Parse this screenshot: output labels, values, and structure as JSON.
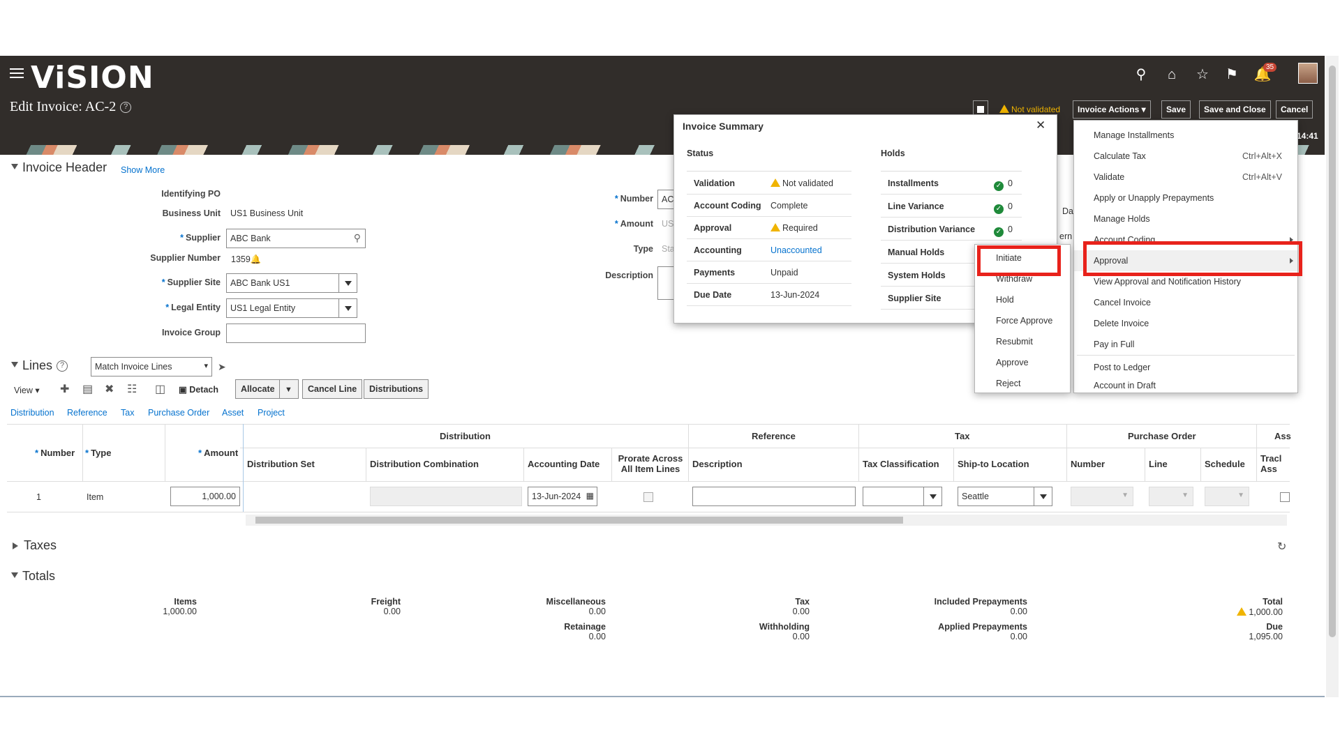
{
  "app": {
    "logo": "ViSION",
    "page_title": "Edit Invoice: AC-2",
    "help": "?",
    "notif_count": "35",
    "time": "14:41"
  },
  "header_actions": {
    "status": "Not validated",
    "invoice_actions": "Invoice Actions",
    "save": "Save",
    "save_close": "Save and Close",
    "cancel": "Cancel"
  },
  "invoice_header": {
    "title": "Invoice Header",
    "show_more": "Show More",
    "identifying_po_label": "Identifying PO",
    "business_unit_label": "Business Unit",
    "business_unit": "US1 Business Unit",
    "supplier_label": "Supplier",
    "supplier": "ABC Bank",
    "supplier_number_label": "Supplier Number",
    "supplier_number": "1359",
    "supplier_site_label": "Supplier Site",
    "supplier_site": "ABC Bank US1",
    "legal_entity_label": "Legal Entity",
    "legal_entity": "US1 Legal Entity",
    "invoice_group_label": "Invoice Group",
    "invoice_group": "",
    "number_label": "Number",
    "number": "AC",
    "amount_label": "Amount",
    "amount_partial": "US",
    "type_label": "Type",
    "type_partial": "Sta",
    "description_label": "Description",
    "date_partial": "Da",
    "terms_partial": "ern"
  },
  "lines": {
    "title": "Lines",
    "match_select": "Match Invoice Lines",
    "view": "View",
    "detach": "Detach",
    "allocate": "Allocate",
    "cancel_line": "Cancel Line",
    "distributions": "Distributions",
    "tabs": [
      "Distribution",
      "Reference",
      "Tax",
      "Purchase Order",
      "Asset",
      "Project"
    ],
    "groups": {
      "distribution": "Distribution",
      "reference": "Reference",
      "tax": "Tax",
      "po": "Purchase Order",
      "asset": "Ass"
    },
    "columns": {
      "number": "Number",
      "type": "Type",
      "amount": "Amount",
      "dist_set": "Distribution Set",
      "dist_comb": "Distribution Combination",
      "acct_date": "Accounting Date",
      "prorate": "Prorate Across All Item Lines",
      "description": "Description",
      "tax_class": "Tax Classification",
      "ship_to": "Ship-to Location",
      "po_number": "Number",
      "po_line": "Line",
      "po_schedule": "Schedule",
      "track_asset": "Tracl Ass"
    },
    "rows": [
      {
        "number": "1",
        "type": "Item",
        "amount": "1,000.00",
        "acct_date": "13-Jun-2024",
        "ship_to": "Seattle"
      }
    ]
  },
  "taxes": {
    "title": "Taxes"
  },
  "totals": {
    "title": "Totals",
    "items_label": "Items",
    "items": "1,000.00",
    "freight_label": "Freight",
    "freight": "0.00",
    "misc_label": "Miscellaneous",
    "misc": "0.00",
    "retainage_label": "Retainage",
    "retainage": "0.00",
    "tax_label": "Tax",
    "tax": "0.00",
    "withholding_label": "Withholding",
    "withholding": "0.00",
    "incl_prepay_label": "Included Prepayments",
    "incl_prepay": "0.00",
    "appl_prepay_label": "Applied Prepayments",
    "appl_prepay": "0.00",
    "total_label": "Total",
    "total": "1,000.00",
    "due_label": "Due",
    "due": "1,095.00"
  },
  "summary": {
    "title": "Invoice Summary",
    "status_h": "Status",
    "holds_h": "Holds",
    "status_rows": [
      {
        "label": "Validation",
        "value": "Not validated"
      },
      {
        "label": "Account Coding",
        "value": "Complete"
      },
      {
        "label": "Approval",
        "value": "Required"
      },
      {
        "label": "Accounting",
        "value": "Unaccounted"
      },
      {
        "label": "Payments",
        "value": "Unpaid"
      },
      {
        "label": "Due Date",
        "value": "13-Jun-2024"
      }
    ],
    "hold_rows": [
      {
        "label": "Installments",
        "value": "0"
      },
      {
        "label": "Line Variance",
        "value": "0"
      },
      {
        "label": "Distribution Variance",
        "value": "0"
      },
      {
        "label": "Manual Holds",
        "value": ""
      },
      {
        "label": "System Holds",
        "value": ""
      },
      {
        "label": "Supplier Site",
        "value": ""
      }
    ]
  },
  "actions_menu": [
    {
      "label": "Manage Installments",
      "shortcut": ""
    },
    {
      "label": "Calculate Tax",
      "shortcut": "Ctrl+Alt+X"
    },
    {
      "label": "Validate",
      "shortcut": "Ctrl+Alt+V"
    },
    {
      "label": "Apply or Unapply Prepayments",
      "shortcut": ""
    },
    {
      "label": "Manage Holds",
      "shortcut": ""
    },
    {
      "label": "Account Coding",
      "shortcut": ""
    },
    {
      "label": "Approval",
      "shortcut": ""
    },
    {
      "label": "View Approval and Notification History",
      "shortcut": ""
    },
    {
      "label": "Cancel Invoice",
      "shortcut": ""
    },
    {
      "label": "Delete Invoice",
      "shortcut": ""
    },
    {
      "label": "Pay in Full",
      "shortcut": ""
    },
    {
      "label": "Post to Ledger",
      "shortcut": ""
    },
    {
      "label": "Account in Draft",
      "shortcut": ""
    }
  ],
  "approval_submenu": [
    "Initiate",
    "Withdraw",
    "Hold",
    "Force Approve",
    "Resubmit",
    "Approve",
    "Reject"
  ],
  "colors": {
    "header_bg": "#312d2a",
    "link": "#0572ce",
    "highlight": "#e8221b",
    "warning": "#f0b400",
    "success": "#1f8a3a"
  }
}
